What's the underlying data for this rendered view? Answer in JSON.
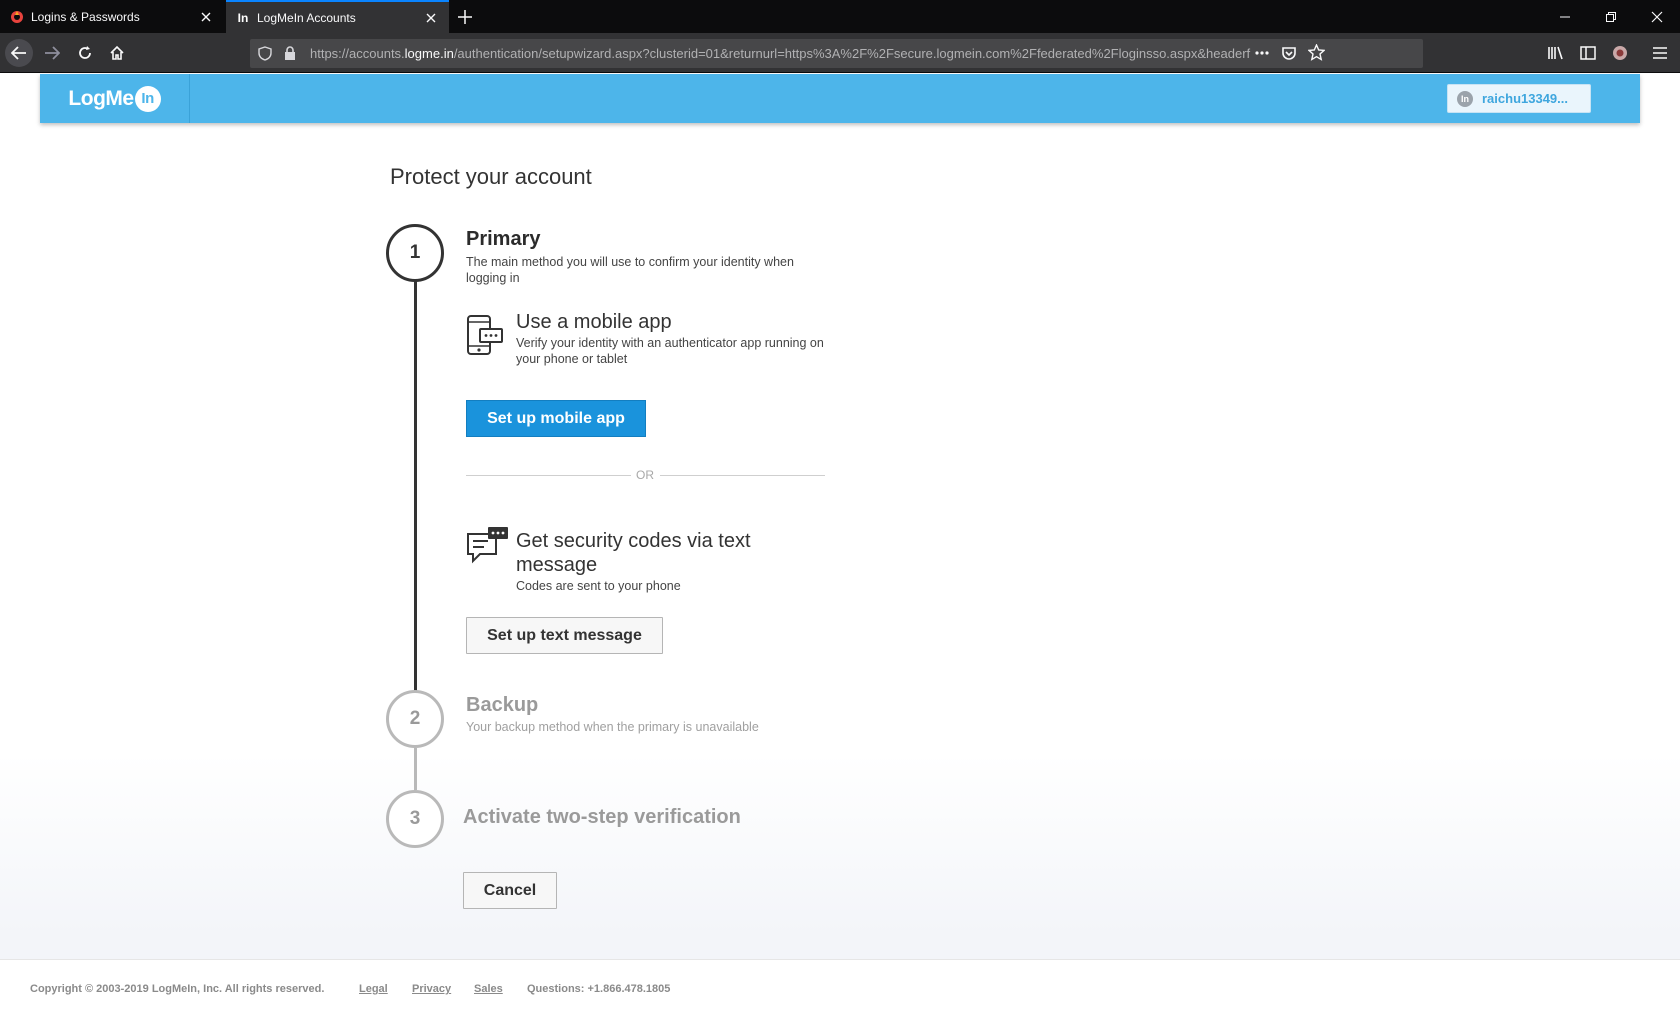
{
  "browser": {
    "tabs": [
      {
        "title": "Logins & Passwords",
        "icon": "lastpass-logo-icon",
        "active": false
      },
      {
        "title": "LogMeIn Accounts",
        "icon": "logmein-favicon-icon",
        "active": true
      }
    ],
    "url_prefix": "https://accounts.",
    "url_domain": "logme.in",
    "url_rest": "/authentication/setupwizard.aspx?clusterid=01&returnurl=https%3A%2F%2Fsecure.logmein.com%2Ffederated%2Floginsso.aspx&headerf"
  },
  "header": {
    "logo_text": "LogMe",
    "logo_badge": "In",
    "user_avatar": "In",
    "user_name": "raichu13349..."
  },
  "main": {
    "title": "Protect your account",
    "steps": [
      {
        "number": "1",
        "title": "Primary",
        "desc": "The main method you will use to confirm your identity when logging in",
        "state": "active"
      },
      {
        "number": "2",
        "title": "Backup",
        "desc": "Your backup method when the primary is unavailable",
        "state": "inactive"
      },
      {
        "number": "3",
        "title": "Activate two-step verification",
        "desc": "",
        "state": "inactive"
      }
    ],
    "methods": [
      {
        "icon": "mobile-app-icon",
        "title": "Use a mobile app",
        "desc": "Verify your identity with an authenticator app running on your phone or tablet",
        "button": "Set up mobile app"
      },
      {
        "icon": "text-message-icon",
        "title": "Get security codes via text message",
        "desc": "Codes are sent to your phone",
        "button": "Set up text message"
      }
    ],
    "or_label": "OR",
    "cancel_label": "Cancel"
  },
  "footer": {
    "copyright": "Copyright © 2003-2019 LogMeIn, Inc. All rights reserved.",
    "links": [
      "Legal",
      "Privacy",
      "Sales"
    ],
    "questions": "Questions: +1.866.478.1805"
  },
  "colors": {
    "header": "#4db5ea",
    "primary_button": "#1a93dc",
    "tab_accent": "#0a84ff"
  }
}
